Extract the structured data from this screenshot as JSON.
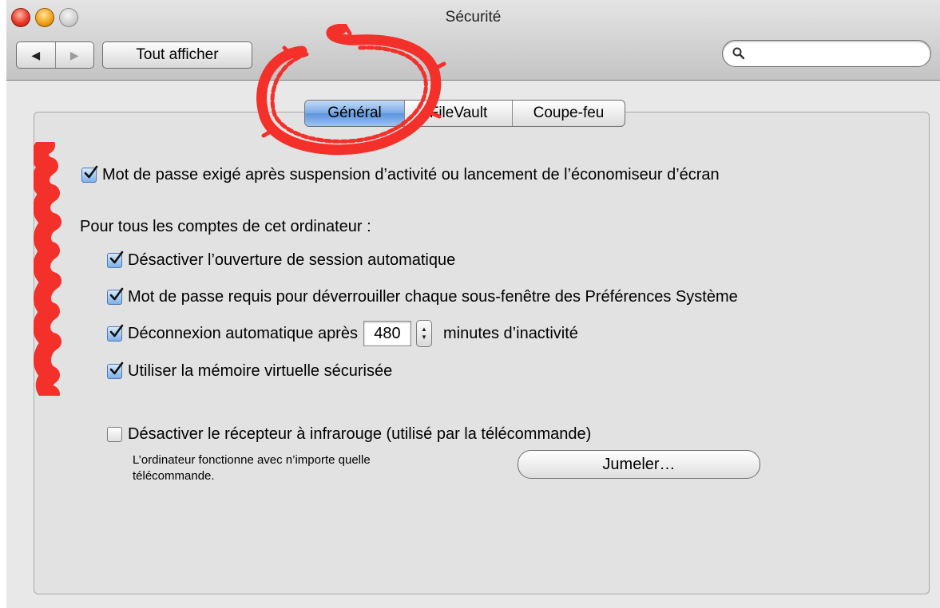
{
  "window": {
    "title": "Sécurité"
  },
  "toolbar": {
    "back": "◀",
    "forward": "▶",
    "show_all": "Tout afficher",
    "search_placeholder": ""
  },
  "tabs": [
    {
      "label": "Général",
      "active": true
    },
    {
      "label": "FileVault",
      "active": false
    },
    {
      "label": "Coupe-feu",
      "active": false
    }
  ],
  "general": {
    "require_password": {
      "label": "Mot de passe exigé après suspension d’activité ou lancement de l’économiseur d’écran",
      "checked": true
    },
    "all_accounts_label": "Pour tous les comptes de cet ordinateur :",
    "disable_auto_login": {
      "label": "Désactiver l’ouverture de session automatique",
      "checked": true
    },
    "require_password_prefs": {
      "label": "Mot de passe requis pour déverrouiller chaque sous-fenêtre des Préférences Système",
      "checked": true
    },
    "auto_logout": {
      "label": "Déconnexion automatique après",
      "value": "480",
      "suffix": "minutes d’inactivité",
      "checked": true
    },
    "secure_vm": {
      "label": "Utiliser la mémoire virtuelle sécurisée",
      "checked": true
    },
    "disable_ir": {
      "label": "Désactiver le récepteur à infrarouge (utilisé par la télécommande)",
      "checked": false
    },
    "ir_note_line1": "L’ordinateur fonctionne avec n’importe quelle",
    "ir_note_line2": "télécommande.",
    "pair_button": "Jumeler…"
  },
  "colors": {
    "annotation": "#f3302a",
    "tab_active": "#6fa2e4",
    "window_bg": "#e8e8e8"
  }
}
